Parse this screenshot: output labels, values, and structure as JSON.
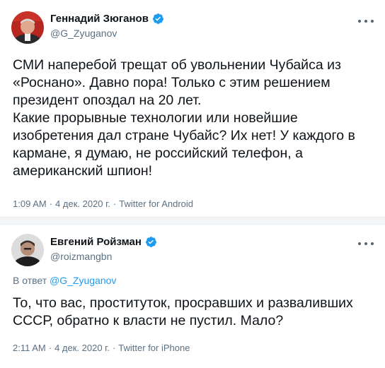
{
  "tweets": [
    {
      "author": "Геннадий Зюганов",
      "handle": "@G_Zyuganov",
      "text": "СМИ наперебой трещат об увольнении Чубайса из\n«Роснано». Давно пора! Только с этим решением\nпрезидент опоздал на 20 лет.\nКакие прорывные технологии или новейшие\nизобретения дал стране Чубайс? Их нет! У каждого в\nкармане, я думаю, не российский телефон, а\nамериканский шпион!",
      "time": "1:09 AM",
      "date": "4 дек. 2020 г.",
      "client": "Twitter for Android",
      "separator": "·"
    },
    {
      "author": "Евгений Ройзман",
      "handle": "@roizmangbn",
      "reply_prefix": "В ответ",
      "reply_to": "@G_Zyuganov",
      "text": "То, что вас, проституток, просравших и разваливших\nСССР, обратно к власти не пустил. Мало?",
      "time": "2:11 AM",
      "date": "4 дек. 2020 г.",
      "client": "Twitter for iPhone",
      "separator": "·"
    }
  ],
  "icons": {
    "verified": "verified-badge-icon",
    "more": "more-dots-icon"
  },
  "colors": {
    "accent": "#1d9bf0",
    "secondary_text": "#5b7083",
    "primary_text": "#0f1419"
  }
}
